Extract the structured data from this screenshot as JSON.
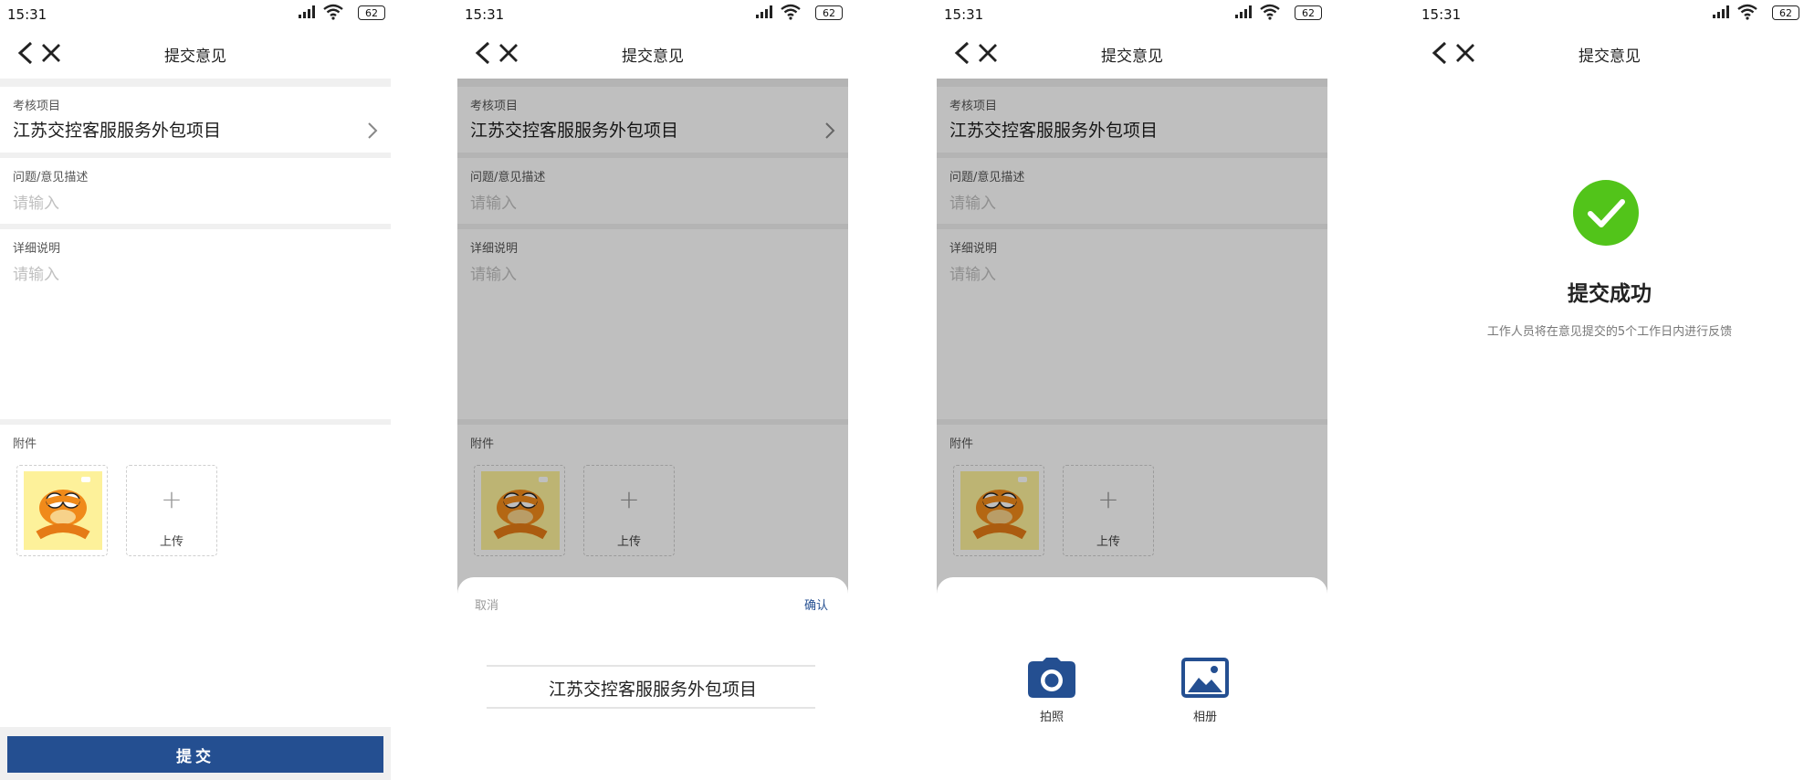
{
  "status": {
    "time": "15:31",
    "battery": "62"
  },
  "nav": {
    "title": "提交意见"
  },
  "form": {
    "project_label": "考核项目",
    "project_value": "江苏交控客服服务外包项目",
    "desc_label": "问题/意见描述",
    "desc_placeholder": "请输入",
    "detail_label": "详细说明",
    "detail_placeholder": "请输入",
    "attach_label": "附件",
    "upload_label": "上传",
    "submit_label": "提交"
  },
  "picker": {
    "cancel": "取消",
    "confirm": "确认",
    "options": [
      "江苏交控客服服务外包项目"
    ]
  },
  "media": {
    "camera": "拍照",
    "album": "相册"
  },
  "success": {
    "title": "提交成功",
    "subtitle": "工作人员将在意见提交的5个工作日内进行反馈"
  },
  "colors": {
    "primary": "#244f91",
    "success": "#52c41a",
    "mask": "rgba(0,0,0,0.25)"
  },
  "icons": [
    "back-arrow-icon",
    "close-icon",
    "chevron-right-icon",
    "plus-icon",
    "camera-icon",
    "image-icon",
    "check-circle-icon",
    "signal-icon",
    "wifi-icon",
    "battery-icon"
  ]
}
